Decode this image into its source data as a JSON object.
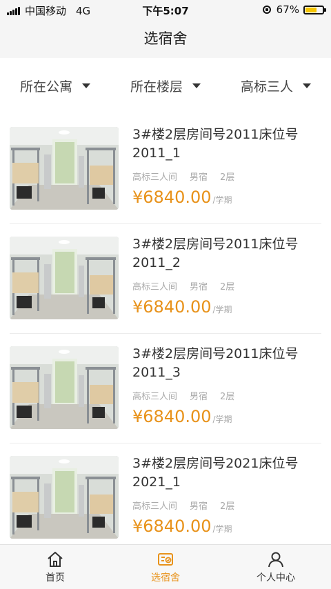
{
  "status_bar": {
    "carrier": "中国移动",
    "network": "4G",
    "time": "下午5:07",
    "battery_percent": "67%",
    "battery_level": 0.67,
    "battery_color": "#f5c400"
  },
  "nav": {
    "title": "选宿舍"
  },
  "filters": [
    {
      "label": "所在公寓",
      "icon": "caret-down-icon"
    },
    {
      "label": "所在楼层",
      "icon": "caret-down-icon"
    },
    {
      "label": "高标三人",
      "icon": "caret-down-icon"
    }
  ],
  "rooms": [
    {
      "title": "3#楼2层房间号2011床位号2011_1",
      "type": "高标三人间",
      "gender": "男宿",
      "floor": "2层",
      "price": "¥6840.00",
      "unit": "/学期"
    },
    {
      "title": "3#楼2层房间号2011床位号2011_2",
      "type": "高标三人间",
      "gender": "男宿",
      "floor": "2层",
      "price": "¥6840.00",
      "unit": "/学期"
    },
    {
      "title": "3#楼2层房间号2011床位号2011_3",
      "type": "高标三人间",
      "gender": "男宿",
      "floor": "2层",
      "price": "¥6840.00",
      "unit": "/学期"
    },
    {
      "title": "3#楼2层房间号2021床位号2021_1",
      "type": "高标三人间",
      "gender": "男宿",
      "floor": "2层",
      "price": "¥6840.00",
      "unit": "/学期"
    }
  ],
  "tabs": [
    {
      "label": "首页",
      "icon": "home-icon",
      "active": false
    },
    {
      "label": "选宿舍",
      "icon": "dorm-select-icon",
      "active": true
    },
    {
      "label": "个人中心",
      "icon": "user-icon",
      "active": false
    }
  ],
  "colors": {
    "accent": "#e8921a",
    "muted": "#aaaaaa",
    "bar_bg": "#f5f5f5"
  }
}
